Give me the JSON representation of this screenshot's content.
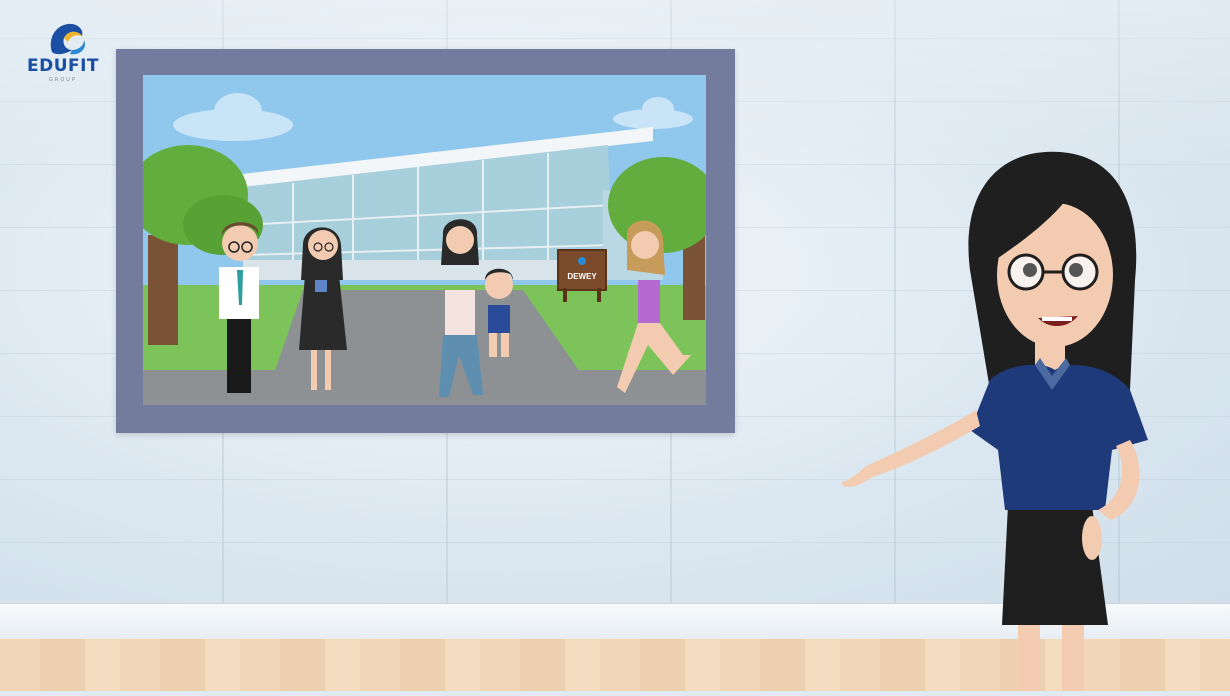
{
  "logo": {
    "name": "EDUFIT",
    "sub": "GROUP"
  },
  "scene": {
    "sign_text": "DEWEY"
  },
  "icons": [
    "edufit-logo-icon",
    "tree-icon",
    "building-icon",
    "sign-icon",
    "person-icon",
    "presenter-icon"
  ],
  "colors": {
    "frame": "#747c9e",
    "sky": "#8fc8ec",
    "grass": "#7cc35a",
    "wall": "#dce8f1",
    "floor": "#f1d6b7",
    "shirt": "#1f3a7a"
  }
}
